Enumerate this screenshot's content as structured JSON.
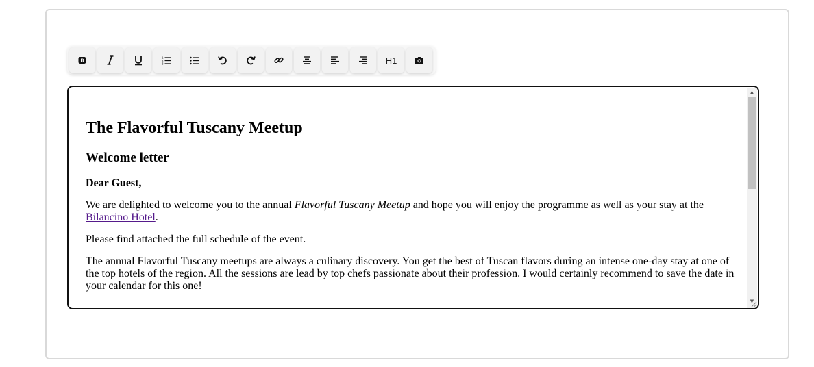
{
  "toolbar": {
    "buttons": [
      {
        "id": "bold",
        "icon": "bold-icon"
      },
      {
        "id": "italic",
        "icon": "italic-icon"
      },
      {
        "id": "underline",
        "icon": "underline-icon"
      },
      {
        "id": "ordered-list",
        "icon": "ordered-list-icon"
      },
      {
        "id": "bullet-list",
        "icon": "bullet-list-icon"
      },
      {
        "id": "undo",
        "icon": "undo-icon"
      },
      {
        "id": "redo",
        "icon": "redo-icon"
      },
      {
        "id": "link",
        "icon": "link-icon"
      },
      {
        "id": "align-center",
        "icon": "align-center-icon"
      },
      {
        "id": "align-left",
        "icon": "align-left-icon"
      },
      {
        "id": "align-right",
        "icon": "align-right-icon"
      },
      {
        "id": "heading-1",
        "icon": "heading-icon",
        "label": "H1"
      },
      {
        "id": "image",
        "icon": "camera-icon"
      }
    ]
  },
  "document": {
    "title": "The Flavorful Tuscany Meetup",
    "subtitle": "Welcome letter",
    "greeting": "Dear Guest,",
    "para1_before": "We are delighted to welcome you to the annual ",
    "para1_emphasis": "Flavorful Tuscany Meetup",
    "para1_middle": " and hope you will enjoy the programme as well as your stay at the ",
    "para1_link": "Bilancino Hotel",
    "para1_after": ".",
    "para2": "Please find attached the full schedule of the event.",
    "para3": "The annual Flavorful Tuscany meetups are always a culinary discovery. You get the best of Tuscan flavors during an intense one-day stay at one of the top hotels of the region. All the sessions are lead by top chefs passionate about their profession. I would certainly recommend to save the date in your calendar for this one!"
  },
  "colors": {
    "link": "#551a8b",
    "editor_border": "#111111",
    "outer_border": "#d9d9d9"
  }
}
